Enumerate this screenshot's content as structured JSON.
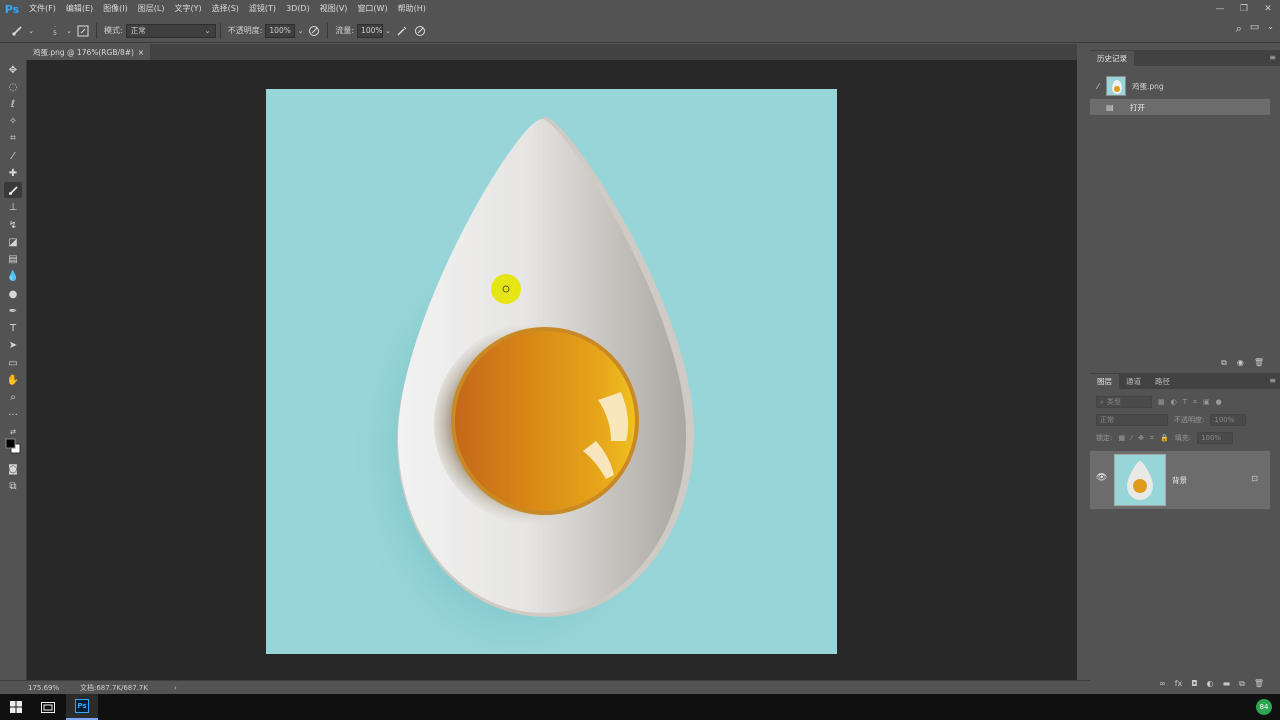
{
  "app": {
    "logo": "Ps",
    "menu": [
      "文件(F)",
      "编辑(E)",
      "图像(I)",
      "图层(L)",
      "文字(Y)",
      "选择(S)",
      "滤镜(T)",
      "3D(D)",
      "视图(V)",
      "窗口(W)",
      "帮助(H)"
    ],
    "window_controls": [
      "minimize-icon",
      "restore-icon",
      "close-icon"
    ]
  },
  "options": {
    "brush_size": "5",
    "mode_label": "模式:",
    "mode_value": "正常",
    "opacity_label": "不透明度:",
    "opacity_value": "100%",
    "flow_label": "流量:",
    "flow_value": "100%"
  },
  "document": {
    "tab_label": "鸡蛋.png @ 176%(RGB/8#)",
    "tab_close": "×",
    "canvas_bg": "#97d5d8"
  },
  "status": {
    "zoom": "175.69%",
    "doc_size": "文档:687.7K/687.7K",
    "arrow": "›"
  },
  "history": {
    "tab_label": "历史记录",
    "snapshot_label": "鸡蛋.png",
    "steps": [
      {
        "label": "打开"
      }
    ]
  },
  "layers": {
    "tabs": [
      "图层",
      "通道",
      "路径"
    ],
    "filter_placeholder": "类型",
    "blend_mode": "正常",
    "opacity_label": "不透明度:",
    "opacity_value": "100%",
    "lock_label": "锁定:",
    "fill_label": "填充:",
    "fill_value": "100%",
    "items": [
      {
        "name": "背景",
        "visible": true,
        "locked": true
      }
    ]
  },
  "taskbar": {
    "ps_label": "Ps",
    "tray_badge": "84"
  },
  "colors": {
    "accent": "#31a8ff",
    "yolk": "#e6a01a",
    "egg_white": "#e8e8e8",
    "cursor": "#e8e800"
  }
}
